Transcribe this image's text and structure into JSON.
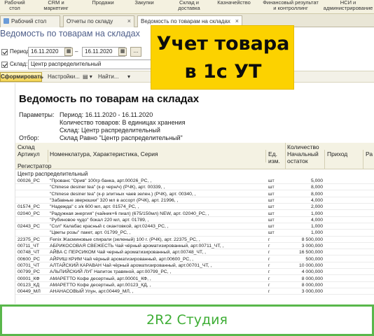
{
  "sections": [
    {
      "line1": "Рабочий",
      "line2": "стол"
    },
    {
      "line1": "CRM и",
      "line2": "маркетинг"
    },
    {
      "line1": "Продажи",
      "line2": ""
    },
    {
      "line1": "Закупки",
      "line2": ""
    },
    {
      "line1": "Склад и",
      "line2": "доставка"
    },
    {
      "line1": "Казначейство",
      "line2": ""
    },
    {
      "line1": "Финансовый результат",
      "line2": "и контроллинг"
    },
    {
      "line1": "НСИ и",
      "line2": "администрирование"
    }
  ],
  "tabs": [
    {
      "label": "Рабочий стол"
    },
    {
      "label": "Отчеты по складу",
      "close": "×"
    },
    {
      "label": "Ведомость по товарам на складах",
      "close": "×"
    }
  ],
  "form_title": "Ведомость по товарам на складах",
  "filters": {
    "period_label": "Период:",
    "date_from": "16.11.2020",
    "date_sep": "–",
    "date_to": "16.11.2020",
    "dots": "...",
    "warehouse_label": "Склад:",
    "warehouse_value": "Центр распределительный"
  },
  "toolbar": {
    "generate_label": "Сформировать",
    "settings_label": "Настройки...",
    "find_label": "Найти..."
  },
  "report": {
    "title": "Ведомость по товарам на складах",
    "params_label": "Параметры:",
    "period_line": "Период: 16.11.2020 - 16.11.2020",
    "qty_line": "Количество товаров: В единицах хранения",
    "warehouse_line": "Склад: Центр распределительный",
    "selection_label": "Отбор:",
    "selection_value": "Склад Равно \"Центр распределительный\"",
    "header": {
      "warehouse": "Склад",
      "article": "Артикул",
      "nomenclature": "Номенклатура, Характеристика, Серия",
      "unit_line1": "Ед.",
      "unit_line2": "изм.",
      "quantity": "Количество",
      "opening_line1": "Начальный",
      "opening_line2": "остаток",
      "income": "Приход",
      "extra": "Ра",
      "registrar": "Регистратор"
    },
    "group_name": "Центр распределительный",
    "rows": [
      {
        "article": "00026_РС",
        "name": "\"Прованс \"Орив\" 100гр банка, арт.00026_РС, ,",
        "unit": "шт",
        "qty": "5,000"
      },
      {
        "article": "",
        "name": "\"Chinese desiner tea\" (к-р черн/ч) (РЧК), арт. 00339, ,",
        "unit": "шт",
        "qty": "8,000"
      },
      {
        "article": "",
        "name": "\"Chinese desiner tea\" (к-р элитных чаев зелен.) (РЧК), арт. 00340, ,",
        "unit": "шт",
        "qty": "8,000"
      },
      {
        "article": "",
        "name": "\"Забавные зверюшки\" 320 мл в ассорт (РЧК), арт. 21996, ,",
        "unit": "шт",
        "qty": "4,000"
      },
      {
        "article": "01574_РС",
        "name": "\"Надежда\" с з/к 600 мл, арт. 01574_РС, ,",
        "unit": "шт",
        "qty": "2,000"
      },
      {
        "article": "02040_РС",
        "name": "\"Радужная энергия\" (чайник+6 пиал) (675/150мл) NEW, арт. 02040_РС, ,",
        "unit": "шт",
        "qty": "1,000"
      },
      {
        "article": "",
        "name": "\"Рубиновое чудо\" бокал 220 мл, арт. 01789, ,",
        "unit": "шт",
        "qty": "4,000"
      },
      {
        "article": "02443_РС",
        "name": "\"Сол\" Калабас красный с окантовкой, арт.02443_РС, ,",
        "unit": "шт",
        "qty": "1,000"
      },
      {
        "article": "",
        "name": "\"Цветы розы\" пакет, арт. 01799_РС, ,",
        "unit": "шт",
        "qty": "1,000"
      },
      {
        "article": "22375_РС",
        "name": "Fenix Жасминовые спирали (зеленый) 100 г. (РЧК), арт. 22375_РС, ,",
        "unit": "г",
        "qty": "8 500,000"
      },
      {
        "article": "00711_ЧТ",
        "name": "АБРИКОСОВАЯ СВЕЖЕСТЬ Чай чёрный ароматизированный, арт.00711_ЧТ, ,",
        "unit": "г",
        "qty": "3 000,000"
      },
      {
        "article": "00748_ЧТ",
        "name": "АЙВА С ПЕРСИКОМ Чай черный ароматизированный, арт.00748_ЧТ, ,",
        "unit": "г",
        "qty": "16 500,000"
      },
      {
        "article": "00600_РС",
        "name": "АЙРИШ КРИМ Чай чёрный ароматизированный, арт.00600_РС, ,",
        "unit": "г",
        "qty": "500,000"
      },
      {
        "article": "00701_ЧТ",
        "name": "АЛТАЙСКИЙ КАРАВАН Чай чёрный ароматизированный, арт.00701_ЧТ, ,",
        "unit": "г",
        "qty": "10 000,000"
      },
      {
        "article": "00799_РС",
        "name": "АЛЬПИЙСКИЙ ЛУГ Напиток травяной, арт.00799_РС, ,",
        "unit": "г",
        "qty": "4 000,000"
      },
      {
        "article": "00001_КФ",
        "name": "АМАРЕТТО Кофе десертный, арт.00001_КФ, ,",
        "unit": "г",
        "qty": "8 000,000"
      },
      {
        "article": "00123_КД",
        "name": "АМАРЕТТО Кофе десертный, арт.00123_КД, ,",
        "unit": "г",
        "qty": "8 000,000"
      },
      {
        "article": "00449_МЛ",
        "name": "АНАНАСОВЫЙ Улун, арт.00449_МЛ, ,",
        "unit": "г",
        "qty": "3 000,000"
      }
    ]
  },
  "badge": {
    "line1": "Учет товара",
    "line2": "в 1с УТ"
  },
  "footer_text": "2R2 Студия",
  "colors": {
    "badge": "#fcd200",
    "footer_border": "#59b74b",
    "footer_text": "#3fae36",
    "form_title": "#4f5f8a",
    "generate_button": "#f2d14d"
  }
}
